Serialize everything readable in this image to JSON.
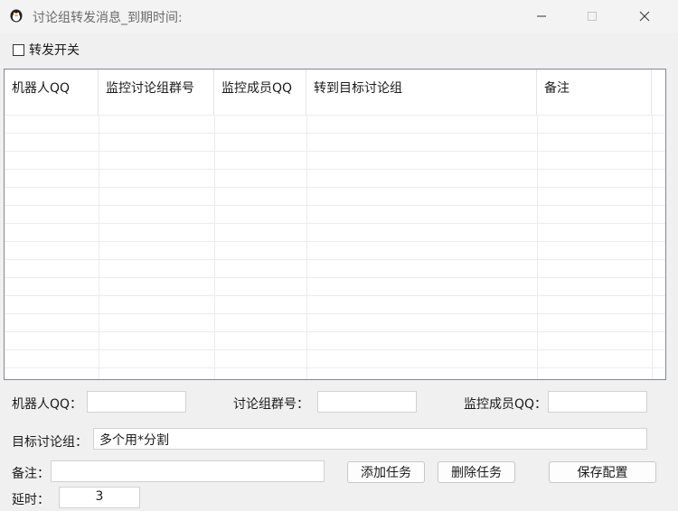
{
  "window": {
    "title": "讨论组转发消息_到期时间:",
    "icon": "qq-penguin-icon"
  },
  "forward_toggle": {
    "label": "转发开关",
    "checked": false
  },
  "table": {
    "columns": [
      "机器人QQ",
      "监控讨论组群号",
      "监控成员QQ",
      "转到目标讨论组",
      "备注"
    ],
    "rows": []
  },
  "form": {
    "robot_qq_label": "机器人QQ：",
    "robot_qq_value": "",
    "group_no_label": "讨论组群号：",
    "group_no_value": "",
    "member_qq_label": "监控成员QQ：",
    "member_qq_value": "",
    "target_label": "目标讨论组：",
    "target_value": "多个用*分割",
    "remark_label": "备注：",
    "remark_value": "",
    "delay_label": "延时：",
    "delay_value": "3"
  },
  "buttons": {
    "add": "添加任务",
    "delete": "删除任务",
    "save": "保存配置"
  }
}
